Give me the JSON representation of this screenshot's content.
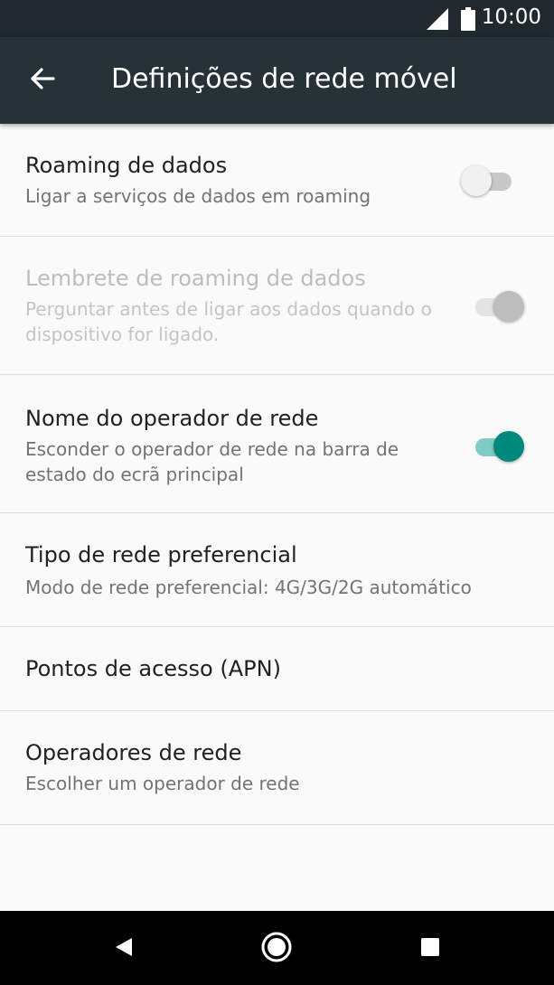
{
  "status_bar": {
    "time": "10:00",
    "icons": [
      "signal-icon",
      "battery-icon"
    ]
  },
  "app_bar": {
    "title": "Definições de rede móvel",
    "back_icon": "arrow-left-icon"
  },
  "settings": [
    {
      "title": "Roaming de dados",
      "summary": "Ligar a serviços de dados em roaming",
      "toggle": "off",
      "enabled": true
    },
    {
      "title": "Lembrete de roaming de dados",
      "summary": "Perguntar antes de ligar aos dados quando o dispositivo for ligado.",
      "toggle": "off",
      "enabled": false
    },
    {
      "title": "Nome do operador de rede",
      "summary": "Esconder o operador de rede na barra de estado do ecrã principal",
      "toggle": "on",
      "enabled": true
    },
    {
      "title": "Tipo de rede preferencial",
      "summary": "Modo de rede preferencial: 4G/3G/2G automático"
    },
    {
      "title": "Pontos de acesso (APN)"
    },
    {
      "title": "Operadores de rede",
      "summary": "Escolher um operador de rede"
    }
  ],
  "colors": {
    "accent": "#00897b",
    "app_bar": "#263238",
    "status_bar": "#20292e"
  },
  "nav_bar": {
    "icons": [
      "back-triangle-icon",
      "home-circle-icon",
      "recents-square-icon"
    ]
  }
}
